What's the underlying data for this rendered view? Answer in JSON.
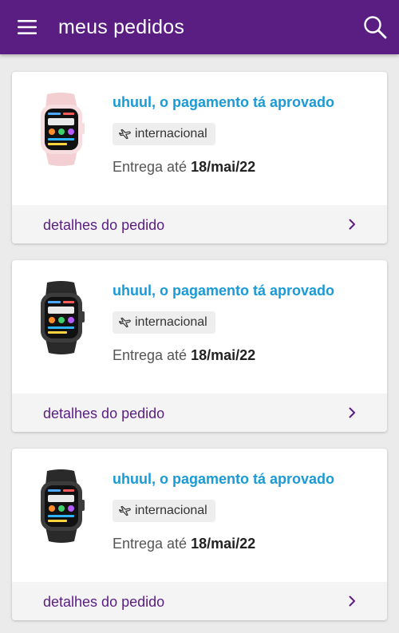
{
  "header": {
    "title": "meus pedidos",
    "menu_icon": "hamburger-menu-icon",
    "search_icon": "search-icon",
    "background_color": "#5a1e82"
  },
  "orders": [
    {
      "status": "uhuul, o pagamento tá aprovado",
      "badge": "internacional",
      "delivery_prefix": "Entrega até",
      "delivery_date": "18/mai/22",
      "details_label": "detalhes do pedido",
      "product_color": "pink"
    },
    {
      "status": "uhuul, o pagamento tá aprovado",
      "badge": "internacional",
      "delivery_prefix": "Entrega até",
      "delivery_date": "18/mai/22",
      "details_label": "detalhes do pedido",
      "product_color": "black"
    },
    {
      "status": "uhuul, o pagamento tá aprovado",
      "badge": "internacional",
      "delivery_prefix": "Entrega até",
      "delivery_date": "18/mai/22",
      "details_label": "detalhes do pedido",
      "product_color": "black"
    }
  ],
  "colors": {
    "status_text": "#1a9ad6",
    "accent": "#5a1e82",
    "page_background": "#ebebeb"
  },
  "icons": {
    "badge": "airplane-icon",
    "footer": "chevron-right-icon",
    "product": "smartwatch-image"
  }
}
